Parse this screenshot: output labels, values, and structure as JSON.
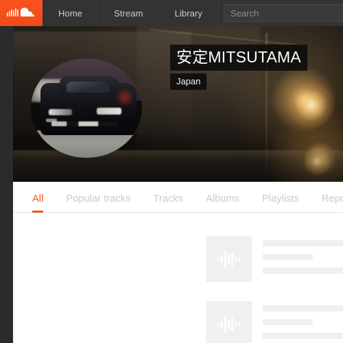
{
  "nav": {
    "logo_icon": "soundcloud-logo-icon",
    "logo_color": "#f0501e",
    "items": [
      {
        "label": "Home"
      },
      {
        "label": "Stream"
      },
      {
        "label": "Library"
      }
    ],
    "search": {
      "placeholder": "Search",
      "value": ""
    }
  },
  "profile": {
    "title": "安定MITSUTAMA",
    "location": "Japan",
    "avatar_name": "profile-avatar-car-photo",
    "banner_name": "profile-banner-night-photo"
  },
  "tabs": [
    {
      "label": "All",
      "active": true
    },
    {
      "label": "Popular tracks",
      "active": false
    },
    {
      "label": "Tracks",
      "active": false
    },
    {
      "label": "Albums",
      "active": false
    },
    {
      "label": "Playlists",
      "active": false
    },
    {
      "label": "Reposts",
      "active": false
    }
  ],
  "accent_color": "#f2520e",
  "placeholder_rows": [
    {
      "icon": "waveform-icon"
    },
    {
      "icon": "waveform-icon"
    }
  ]
}
